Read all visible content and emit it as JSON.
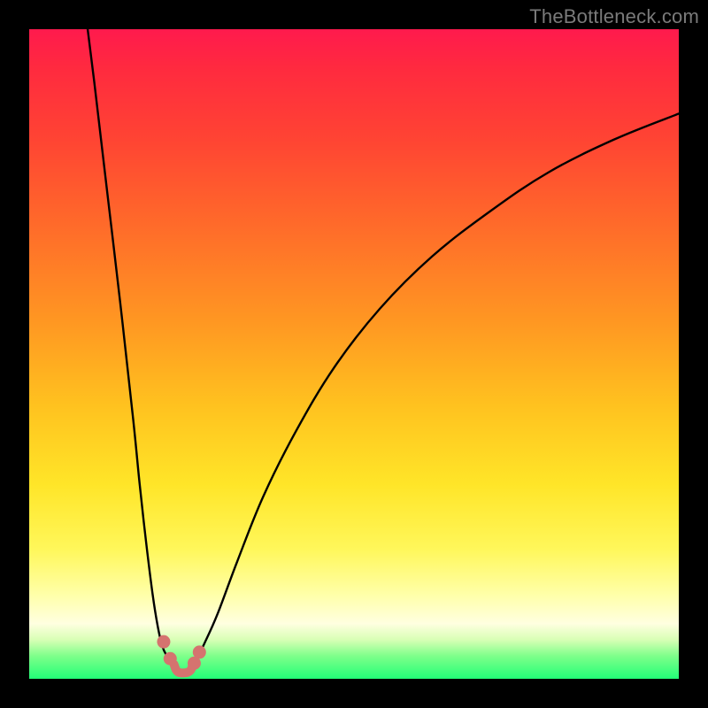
{
  "watermark": "TheBottleneck.com",
  "chart_data": {
    "type": "line",
    "title": "",
    "xlabel": "",
    "ylabel": "",
    "xlim": [
      0,
      100
    ],
    "ylim": [
      0,
      100
    ],
    "grid": false,
    "legend": false,
    "series": [
      {
        "name": "left-curve",
        "x": [
          9,
          10,
          12,
          14,
          16,
          17,
          18,
          19,
          19.8,
          20.5,
          21.2,
          21.8,
          22.3
        ],
        "values": [
          100,
          92,
          75,
          58,
          40,
          30,
          21,
          13,
          8,
          5,
          3.5,
          2.6,
          2.2
        ]
      },
      {
        "name": "right-curve",
        "x": [
          25.2,
          26,
          27,
          29,
          32,
          36,
          41,
          47,
          54,
          62,
          71,
          80,
          90,
          100
        ],
        "values": [
          2.2,
          3.5,
          5.5,
          10,
          18,
          28,
          38,
          48,
          57,
          65,
          72,
          78,
          83,
          87
        ]
      },
      {
        "name": "trough",
        "x": [
          22.3,
          22.6,
          23.0,
          23.7,
          24.4,
          24.9,
          25.2
        ],
        "values": [
          2.2,
          1.4,
          1.0,
          0.9,
          1.0,
          1.4,
          2.2
        ]
      }
    ],
    "markers": [
      {
        "name": "left-dot-upper",
        "x": 20.7,
        "y": 5.7
      },
      {
        "name": "left-dot-lower",
        "x": 21.7,
        "y": 3.1
      },
      {
        "name": "right-dot-upper",
        "x": 26.2,
        "y": 4.1
      },
      {
        "name": "right-dot-lower",
        "x": 25.4,
        "y": 2.4
      }
    ],
    "colors": {
      "curve": "#000000",
      "marker": "#d5736f",
      "background_top": "#ff1a4d",
      "background_bottom": "#22ff77"
    },
    "gradient_bands": [
      {
        "pct": 0,
        "color": "#ff1a4d"
      },
      {
        "pct": 17,
        "color": "#ff4433"
      },
      {
        "pct": 45,
        "color": "#ff9722"
      },
      {
        "pct": 70,
        "color": "#ffe528"
      },
      {
        "pct": 87,
        "color": "#ffffa8"
      },
      {
        "pct": 96.5,
        "color": "#7eff8a"
      },
      {
        "pct": 100,
        "color": "#22ff77"
      }
    ]
  }
}
